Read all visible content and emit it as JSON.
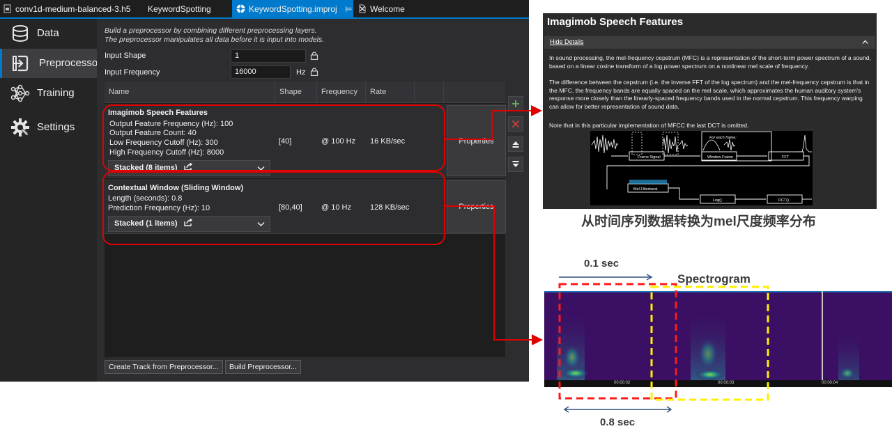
{
  "tabs": [
    {
      "label": "conv1d-medium-balanced-3.h5",
      "active": false
    },
    {
      "label": "KeywordSpotting",
      "active": false
    },
    {
      "label": "KeywordSpotting.improj",
      "active": true
    },
    {
      "label": "Welcome",
      "active": false
    }
  ],
  "nav": [
    {
      "label": "Data",
      "icon": "database-icon"
    },
    {
      "label": "Preprocessor",
      "icon": "login-arrow-icon"
    },
    {
      "label": "Training",
      "icon": "neural-network-icon"
    },
    {
      "label": "Settings",
      "icon": "gear-icon"
    }
  ],
  "main": {
    "desc_line1": "Build a preprocessor by combining different preprocessing layers.",
    "desc_line2": "The preprocessor manipulates all data before it is input into models.",
    "input_shape_label": "Input Shape",
    "input_shape_value": "1",
    "input_freq_label": "Input Frequency",
    "input_freq_value": "16000",
    "input_freq_unit": "Hz",
    "columns": [
      "Name",
      "Shape",
      "Frequency",
      "Rate"
    ],
    "rows": [
      {
        "title": "Imagimob Speech Features",
        "lines": [
          "Output Feature Frequency (Hz): 100",
          "Output Feature Count: 40",
          "Low Frequency Cutoff (Hz): 300",
          "High Frequency Cutoff (Hz): 8000"
        ],
        "shape": "[40]",
        "frequency": "@ 100 Hz",
        "rate": "16 KB/sec",
        "stacked": "Stacked (8 items)",
        "properties": "Properties"
      },
      {
        "title": "Contextual Window (Sliding Window)",
        "lines": [
          "Length (seconds): 0.8",
          "Prediction Frequency (Hz): 10"
        ],
        "shape": "[80,40]",
        "frequency": "@ 10 Hz",
        "rate": "128 KB/sec",
        "stacked": "Stacked (1 items)",
        "properties": "Properties"
      }
    ],
    "create_track_button": "Create Track from Preprocessor...",
    "build_button": "Build Preprocessor..."
  },
  "info": {
    "title": "Imagimob Speech Features",
    "hide_details": "Hide Details",
    "para1": "In sound processing, the mel-frequency cepstrum (MFC) is a representation of the short-term power spectrum of a sound, based on a linear cosine transform of a log power spectrum on a nonlinear mel scale of frequency.",
    "para2": "The difference between the cepstrum (i.e. the inverse FFT of the log spectrum) and the mel-frequency cepstrum is that in the MFC, the frequency bands are equally spaced on the mel scale, which approximates the human auditory system's response more closely than the linearly-spaced frequency bands used in the normal cepstrum. This frequency warping can allow for better representation of sound data.",
    "para3": "Note that in this particular implementation of MFCC the last DCT is omitted.",
    "diagram": {
      "for_each_frame": "For each frame:",
      "frame_signal": "Frame Signal",
      "window_frame": "Window Frame",
      "fft": "FFT",
      "mel_filterbank": "Mel Filterbank",
      "log": "Log()",
      "dct": "DCT()"
    }
  },
  "annotations": {
    "caption": "从时间序列数据转换为mel尺度频率分布",
    "step_label": "0.1 sec",
    "spectrogram_label": "Spectrogram",
    "window_label": "0.8 sec",
    "timestamps": [
      "00:00:02",
      "00:00:03",
      "00:00:04"
    ]
  },
  "colors": {
    "accent": "#007acc",
    "highlight_red": "#e00000",
    "highlight_yellow": "#ffef00",
    "arrow_navy": "#2f4f7f"
  }
}
